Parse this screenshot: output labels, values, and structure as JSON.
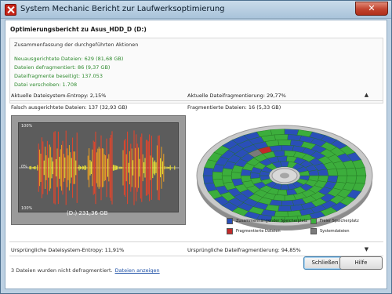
{
  "window": {
    "title": "System Mechanic Bericht zur Laufwerksoptimierung",
    "close_glyph": "✕"
  },
  "report": {
    "title": "Optimierungsbericht zu Asus_HDD_D (D:)",
    "summary_heading": "Zusammenfassung der durchgeführten Aktionen",
    "summary_lines": [
      "Neuausgerichtete Dateien: 629  (81,68 GB)",
      "Dateien defragmentiert: 86  (9,37 GB)",
      "Dateifragmente beseitigt: 137.053",
      "Datei verschoben: 1.708"
    ]
  },
  "current": {
    "entropy_label": "Aktuelle Dateisystem-Entropy: 2,15%",
    "fragmentation_label": "Aktuelle Dateifragmentierung: 29,77%",
    "misaligned_label": "Falsch ausgerichtete Dateien: 137  (32,93 GB)",
    "fragmented_label": "Fragmentierte Dateien: 16  (5,33 GB)"
  },
  "graph": {
    "label_top": "100%",
    "label_mid": "0%",
    "label_bottom": "100%",
    "drive_label": "(D:) 231,36 GB"
  },
  "legend": {
    "contiguous": "Zusammenhängender Speicherplatz",
    "free": "Freier Speicherplatz",
    "fragmented": "Fragmentierte Dateien",
    "system": "Systemdateien"
  },
  "original": {
    "entropy_label": "Ursprüngliche Dateisystem-Entropy: 11,91%",
    "fragmentation_label": "Ursprüngliche Dateifragmentierung: 94,85%"
  },
  "bottom": {
    "note": "3 Dateien wurden nicht defragmentiert.",
    "link": "Dateien anzeigen"
  },
  "buttons": {
    "close": "Schließen",
    "help": "Hilfe"
  },
  "icons": {
    "collapse": "chevron-up-icon",
    "expand": "chevron-down-icon"
  },
  "colors": {
    "contiguous": "#2a4fb8",
    "free": "#3cae3c",
    "fragmented": "#c22a2a",
    "system": "#7a7a7a",
    "summary_text": "#2d8a2d",
    "link": "#1c4fa6"
  }
}
